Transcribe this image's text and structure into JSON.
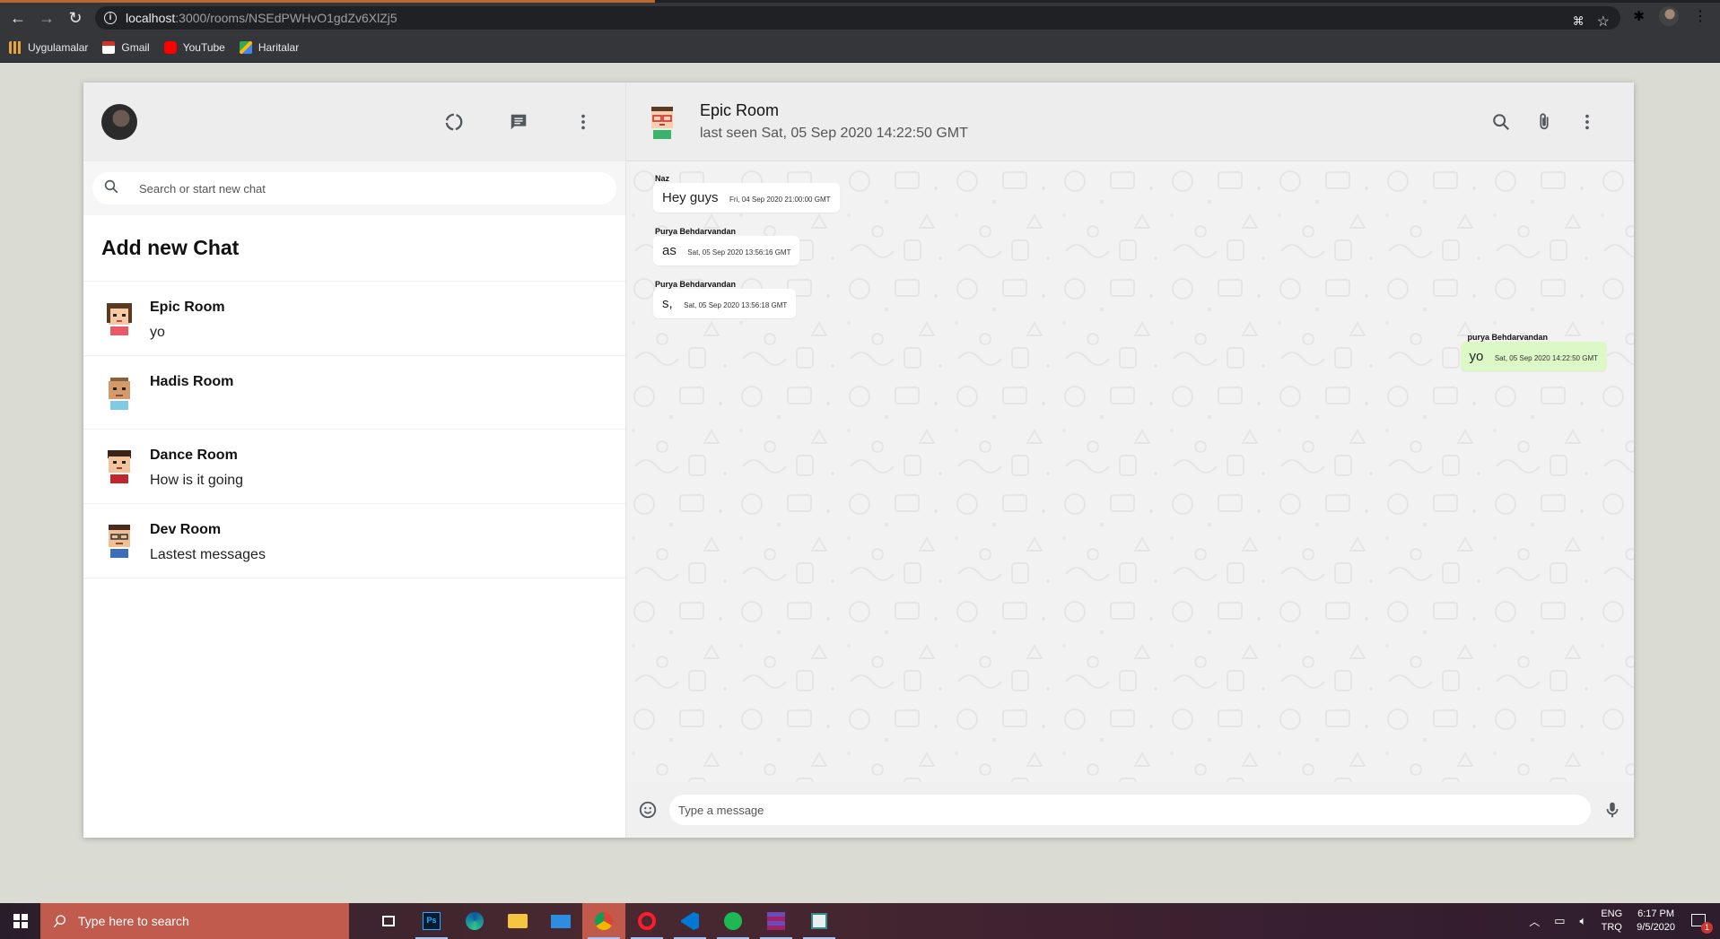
{
  "browser": {
    "url_host": "localhost",
    "url_path": ":3000/rooms/NSEdPWHvO1gdZv6XlZj5",
    "bookmarks": [
      {
        "label": "Uygulamalar",
        "color": "#e8a33d"
      },
      {
        "label": "Gmail",
        "color": "#d93025"
      },
      {
        "label": "YouTube",
        "color": "#ff0000"
      },
      {
        "label": "Haritalar",
        "color": "#34a853"
      }
    ]
  },
  "sidebar": {
    "search_placeholder": "Search or start new chat",
    "add_new_chat": "Add new Chat",
    "chats": [
      {
        "name": "Epic Room",
        "last": "yo"
      },
      {
        "name": "Hadis Room",
        "last": ""
      },
      {
        "name": "Dance Room",
        "last": "How is it going"
      },
      {
        "name": "Dev Room",
        "last": "Lastest messages"
      }
    ]
  },
  "chat": {
    "room_name": "Epic Room",
    "last_seen": "last seen Sat, 05 Sep 2020 14:22:50 GMT",
    "messages": [
      {
        "name": "Naz",
        "text": "Hey guys",
        "time": "Fri, 04 Sep 2020 21:00:00 GMT",
        "mine": false
      },
      {
        "name": "Purya Behdarvandan",
        "text": "as",
        "time": "Sat, 05 Sep 2020 13:56:16 GMT",
        "mine": false
      },
      {
        "name": "Purya Behdarvandan",
        "text": "s,",
        "time": "Sat, 05 Sep 2020 13:56:18 GMT",
        "mine": false
      },
      {
        "name": "purya Behdarvandan",
        "text": "yo",
        "time": "Sat, 05 Sep 2020 14:22:50 GMT",
        "mine": true
      }
    ],
    "input_placeholder": "Type a message"
  },
  "taskbar": {
    "search_placeholder": "Type here to search",
    "lang_top": "ENG",
    "lang_bottom": "TRQ",
    "time": "6:17 PM",
    "date": "9/5/2020",
    "notification_count": "1"
  },
  "colors": {
    "sent_bubble": "#dcf8c6",
    "received_bubble": "#ffffff",
    "header_bg": "#ededed"
  }
}
